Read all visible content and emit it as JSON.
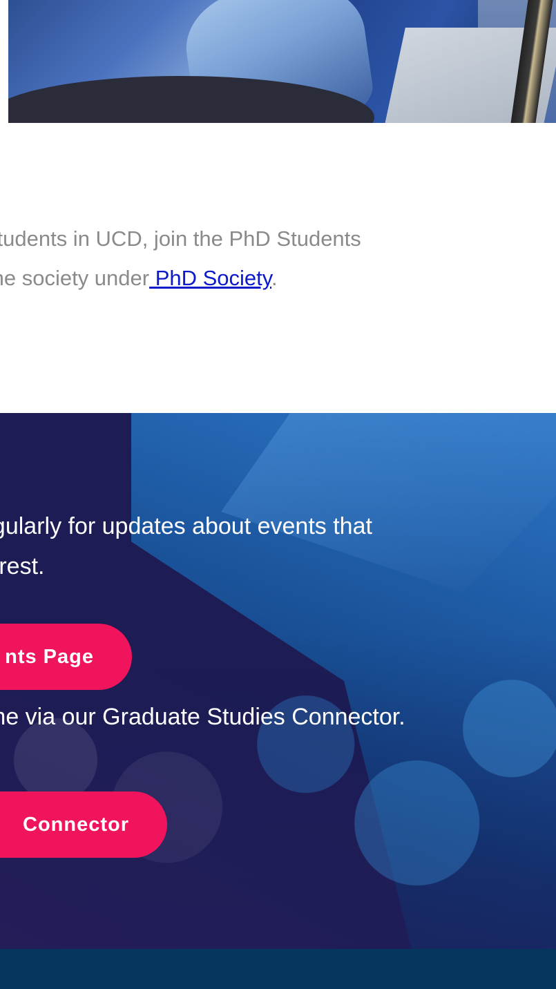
{
  "intro": {
    "line1": "students in UCD, join the PhD Students",
    "line2_prefix": "the society under",
    "link_label": " PhD Society",
    "line2_suffix": "."
  },
  "banner": {
    "line1": "egularly for updates about events that",
    "line2": "terest.",
    "events_button_label": "nts Page",
    "connector_line": "me via our Graduate Studies Connector.",
    "connector_button_label": "Connector"
  },
  "colors": {
    "link": "#0b19c9",
    "button": "#f0145c",
    "banner_bg": "#1d1c54",
    "footer": "#05375e",
    "intro_text": "#8a8a8a"
  }
}
